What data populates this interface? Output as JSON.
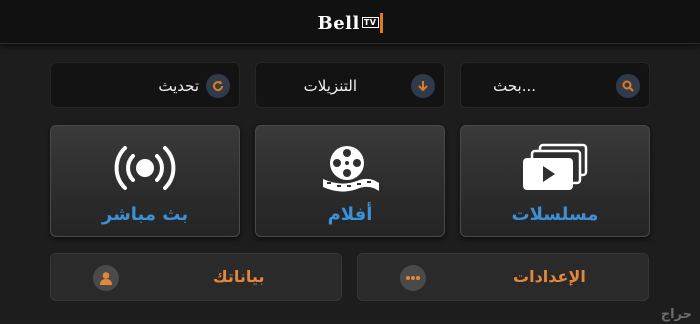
{
  "header": {
    "logo_text": "Bell",
    "logo_tv": "TV"
  },
  "top_buttons": {
    "refresh": {
      "label": "تحديث",
      "icon": "refresh-icon"
    },
    "downloads": {
      "label": "التنزيلات",
      "icon": "download-icon"
    },
    "search": {
      "label": "بحث...",
      "icon": "search-icon"
    }
  },
  "cards": {
    "live": {
      "label": "بث مباشر",
      "icon": "broadcast-icon"
    },
    "movies": {
      "label": "أفلام",
      "icon": "film-reel-icon"
    },
    "series": {
      "label": "مسلسلات",
      "icon": "stacked-video-icon"
    }
  },
  "bottom_buttons": {
    "profile": {
      "label": "بياناتك",
      "icon": "user-icon"
    },
    "settings": {
      "label": "الإعدادات",
      "icon": "more-dots-icon"
    }
  },
  "watermark": "حراج",
  "colors": {
    "accent_blue": "#3d8fd6",
    "accent_orange": "#e3873a",
    "icon_orange": "#e07a1b",
    "background": "#1d1d1d"
  }
}
